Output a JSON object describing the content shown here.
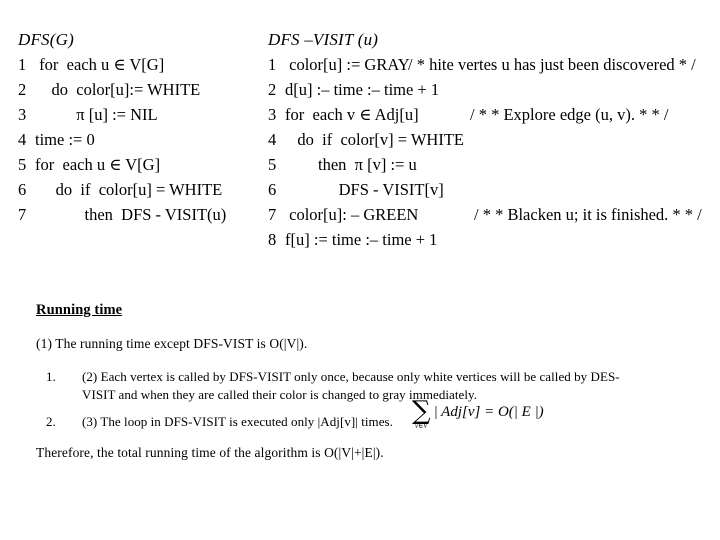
{
  "slide": {
    "background_color": "#ffffff",
    "text_color": "#000000"
  },
  "dfs_g": {
    "title": "DFS(G)",
    "lines": [
      {
        "number": "1",
        "text": " for  each u ∈ V[G]"
      },
      {
        "number": "2",
        "text": "    do  color[u]:= WHITE"
      },
      {
        "number": "3",
        "text": "          π [u] := NIL"
      },
      {
        "number": "4",
        "text": "time := 0"
      },
      {
        "number": "5",
        "text": "for  each u ∈ V[G]"
      },
      {
        "number": "6",
        "text": "     do  if  color[u] = WHITE"
      },
      {
        "number": "7",
        "text": "            then  DFS - VISIT(u)"
      }
    ]
  },
  "dfs_visit": {
    "title": "DFS –VISIT (u)",
    "lines": [
      {
        "number": "1",
        "text": " color[u] := GRAY",
        "comment": "/ * hite vertes u has just been discovered * /"
      },
      {
        "number": "2",
        "text": "d[u] :– time :– time + 1",
        "comment": ""
      },
      {
        "number": "3",
        "text": "for  each v ∈ Adj[u]",
        "comment": "/ * * Explore edge (u, v). * * /"
      },
      {
        "number": "4",
        "text": "   do  if  color[v] = WHITE",
        "comment": ""
      },
      {
        "number": "5",
        "text": "        then  π [v] := u",
        "comment": ""
      },
      {
        "number": "6",
        "text": "             DFS - VISIT[v]",
        "comment": ""
      },
      {
        "number": "7",
        "text": " color[u]: – GREEN",
        "comment": "/ * * Blacken u; it is finished. * * /"
      },
      {
        "number": "8",
        "text": "f[u] := time :– time + 1",
        "comment": ""
      }
    ]
  },
  "running_time": {
    "heading": "Running time",
    "point_1": "(1) The running time except DFS-VIST is O(|V|).",
    "list": [
      {
        "marker": "1.",
        "text": "(2) Each vertex is called by DFS-VISIT only once, because only white vertices will be called by DES-VISIT and when they are called their color is changed to gray immediately."
      },
      {
        "marker": "2.",
        "text": "(3) The loop in DFS-VISIT is executed only |Adj[v]| times."
      }
    ],
    "conclusion": "Therefore, the total running time of the algorithm is O(|V|+|E|)."
  },
  "summation_formula": {
    "sigma": "∑",
    "subscript": "v∈V",
    "body": "| Adj[v] = O(| E |)"
  }
}
